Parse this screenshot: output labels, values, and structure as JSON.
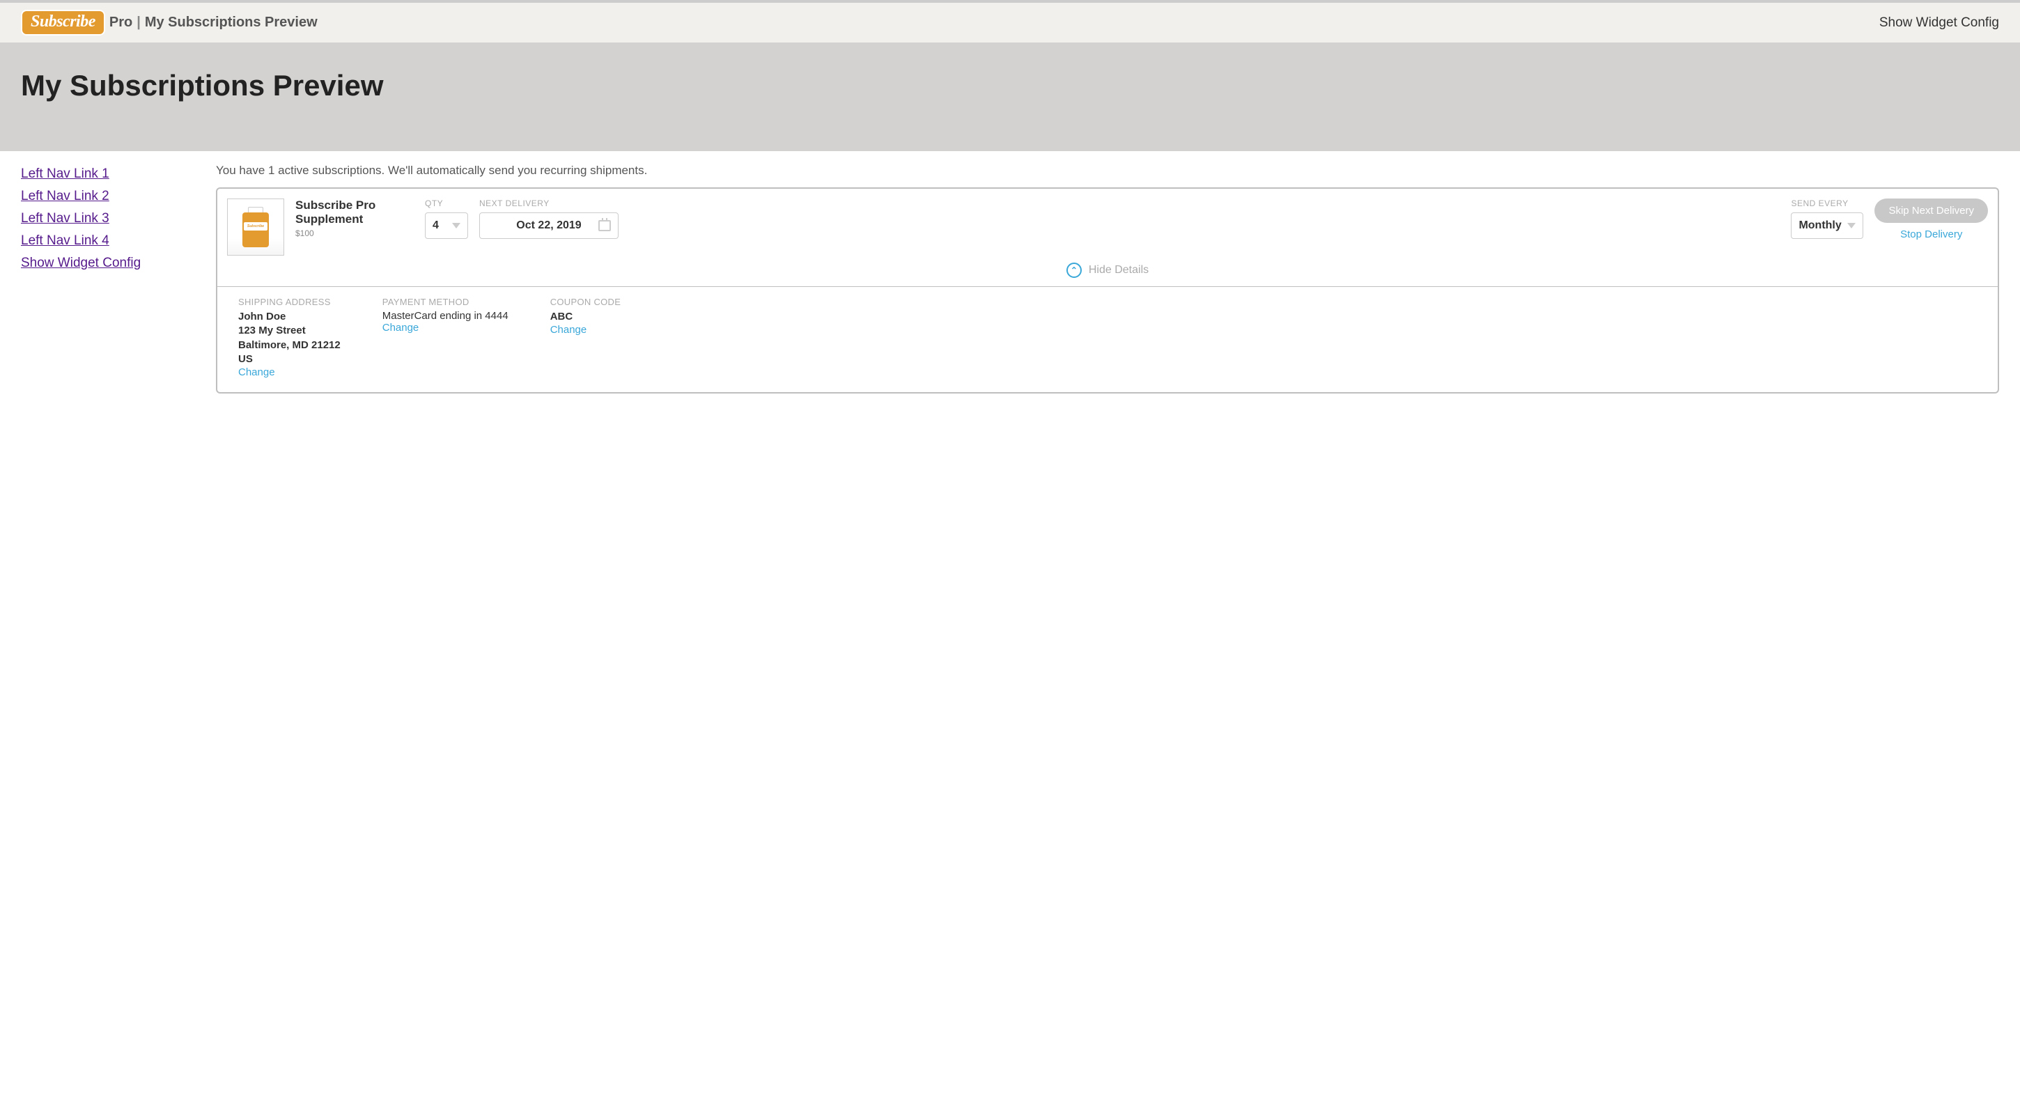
{
  "header": {
    "logo_text": "Subscribe",
    "pro_label": "Pro",
    "separator": "|",
    "crumb": "My Subscriptions Preview",
    "right_link": "Show Widget Config"
  },
  "hero": {
    "title": "My Subscriptions Preview"
  },
  "sidebar": {
    "links": [
      "Left Nav Link 1",
      "Left Nav Link 2",
      "Left Nav Link 3",
      "Left Nav Link 4",
      "Show Widget Config"
    ]
  },
  "intro": "You have 1 active subscriptions. We'll automatically send you recurring shipments.",
  "subscription": {
    "product_name": "Subscribe Pro Supplement",
    "price": "$100",
    "bottle_label": "Subscribe",
    "labels": {
      "qty": "QTY",
      "next_delivery": "NEXT DELIVERY",
      "send_every": "SEND EVERY"
    },
    "qty": "4",
    "next_delivery": "Oct 22, 2019",
    "send_every": "Monthly",
    "skip_label": "Skip Next Delivery",
    "stop_label": "Stop Delivery",
    "toggle_label": "Hide Details",
    "toggle_icon": "⌃",
    "details": {
      "shipping": {
        "heading": "SHIPPING ADDRESS",
        "name": "John Doe",
        "line1": "123 My Street",
        "line2": "Baltimore, MD 21212",
        "country": "US",
        "change": "Change"
      },
      "payment": {
        "heading": "PAYMENT METHOD",
        "value": "MasterCard ending in 4444",
        "change": "Change"
      },
      "coupon": {
        "heading": "COUPON CODE",
        "value": "ABC",
        "change": "Change"
      }
    }
  }
}
